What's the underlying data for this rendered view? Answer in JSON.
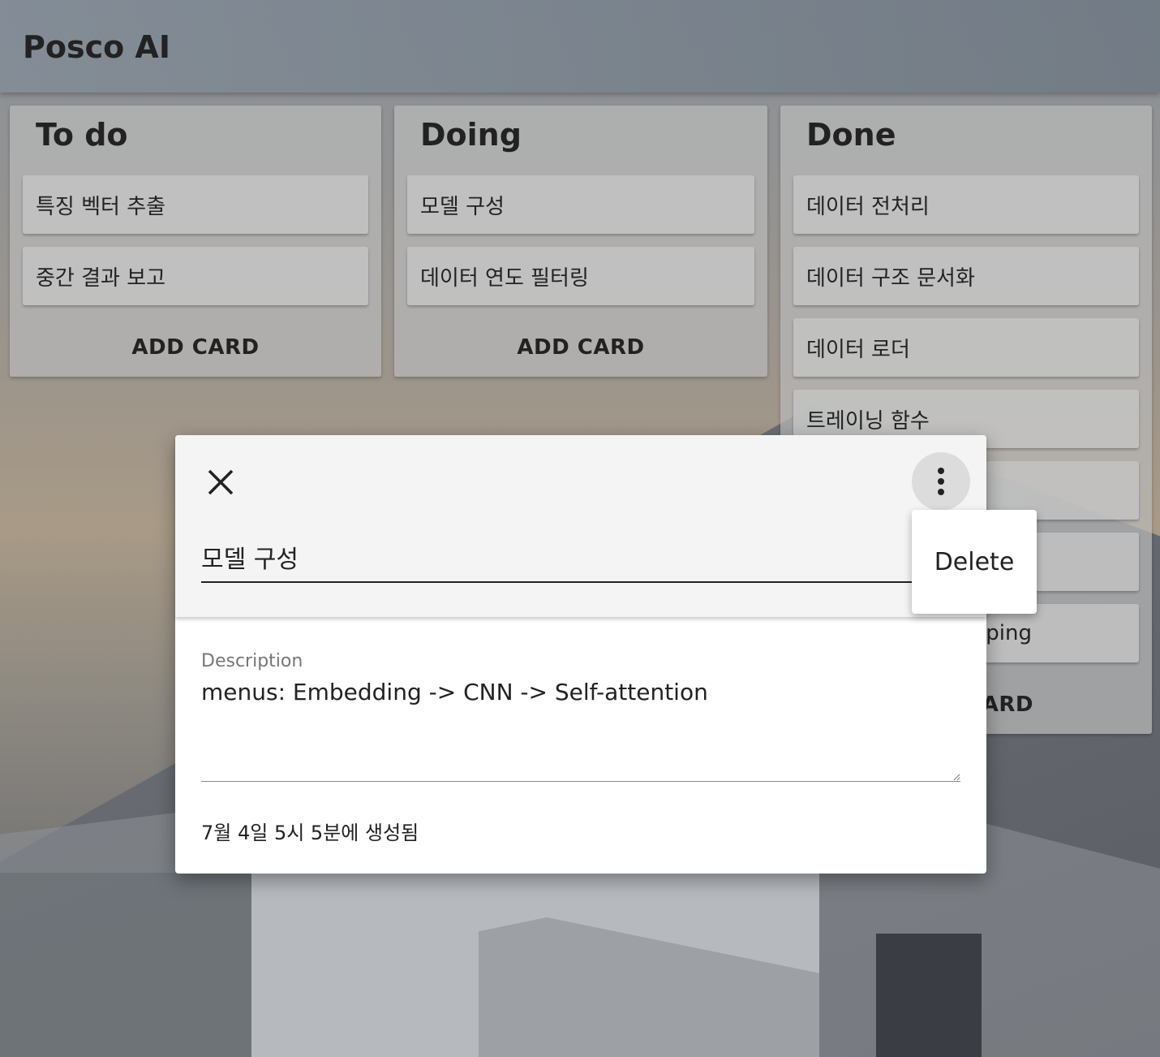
{
  "app": {
    "title": "Posco AI"
  },
  "columns": [
    {
      "title": "To do",
      "cards": [
        "특징 벡터 추출",
        "중간 결과 보고"
      ],
      "add_label": "ADD CARD"
    },
    {
      "title": "Doing",
      "cards": [
        "모델 구성",
        "데이터 연도 필터링"
      ],
      "add_label": "ADD CARD"
    },
    {
      "title": "Done",
      "cards": [
        "데이터 전처리",
        "데이터 구조 문서화",
        "데이터 로더",
        "트레이닝 함수",
        "",
        "",
        "ping"
      ],
      "add_label": "ARD"
    }
  ],
  "modal": {
    "title_value": "모델 구성",
    "description_label": "Description",
    "description_value": "menus: Embedding -> CNN -> Self-attention",
    "created_text": "7월 4일 5시 5분에 생성됨",
    "menu": {
      "delete_label": "Delete"
    }
  },
  "icons": {
    "close": "close-icon",
    "more": "more-vert-icon"
  }
}
